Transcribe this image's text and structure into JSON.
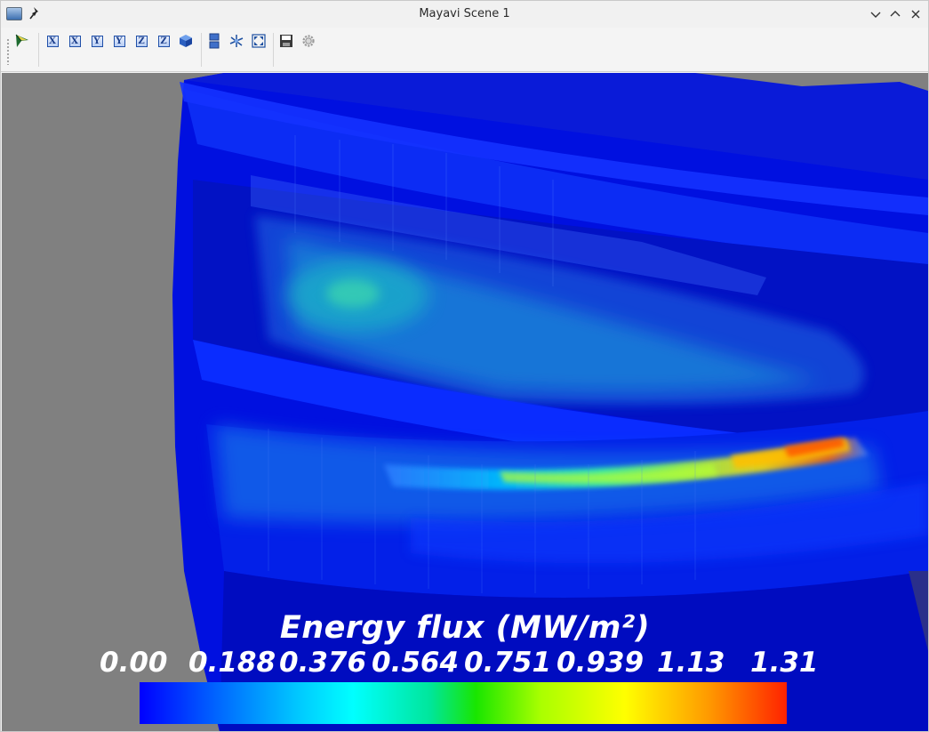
{
  "window": {
    "title": "Mayavi Scene 1",
    "icons": [
      "scene-icon",
      "pin-icon",
      "minimize-icon",
      "maximize-icon",
      "close-icon"
    ]
  },
  "toolbar": {
    "buttons": [
      {
        "name": "mayavi-logo-button",
        "icon": "mayavi-icon"
      },
      {
        "name": "view-x-plus-button",
        "label": "X"
      },
      {
        "name": "view-x-minus-button",
        "label": "X"
      },
      {
        "name": "view-y-plus-button",
        "label": "Y"
      },
      {
        "name": "view-y-minus-button",
        "label": "Y"
      },
      {
        "name": "view-z-plus-button",
        "label": "Z"
      },
      {
        "name": "view-z-minus-button",
        "label": "Z"
      },
      {
        "name": "isometric-view-button",
        "icon": "cube-icon"
      },
      {
        "name": "parallel-projection-button",
        "icon": "projection-icon"
      },
      {
        "name": "show-axes-button",
        "icon": "axes-icon"
      },
      {
        "name": "full-screen-button",
        "icon": "fullscreen-icon"
      },
      {
        "name": "save-scene-button",
        "icon": "save-icon"
      },
      {
        "name": "configure-scene-button",
        "icon": "gear-icon"
      }
    ]
  },
  "scene": {
    "background_color": "#808080",
    "colorbar": {
      "title": "Energy flux (MW/m²)",
      "ticks": [
        "0.00",
        "0.188",
        "0.376",
        "0.564",
        "0.751",
        "0.939",
        "1.13",
        "1.31"
      ],
      "range": [
        0.0,
        1.31
      ],
      "colormap": "jet",
      "orientation": "horizontal"
    }
  }
}
